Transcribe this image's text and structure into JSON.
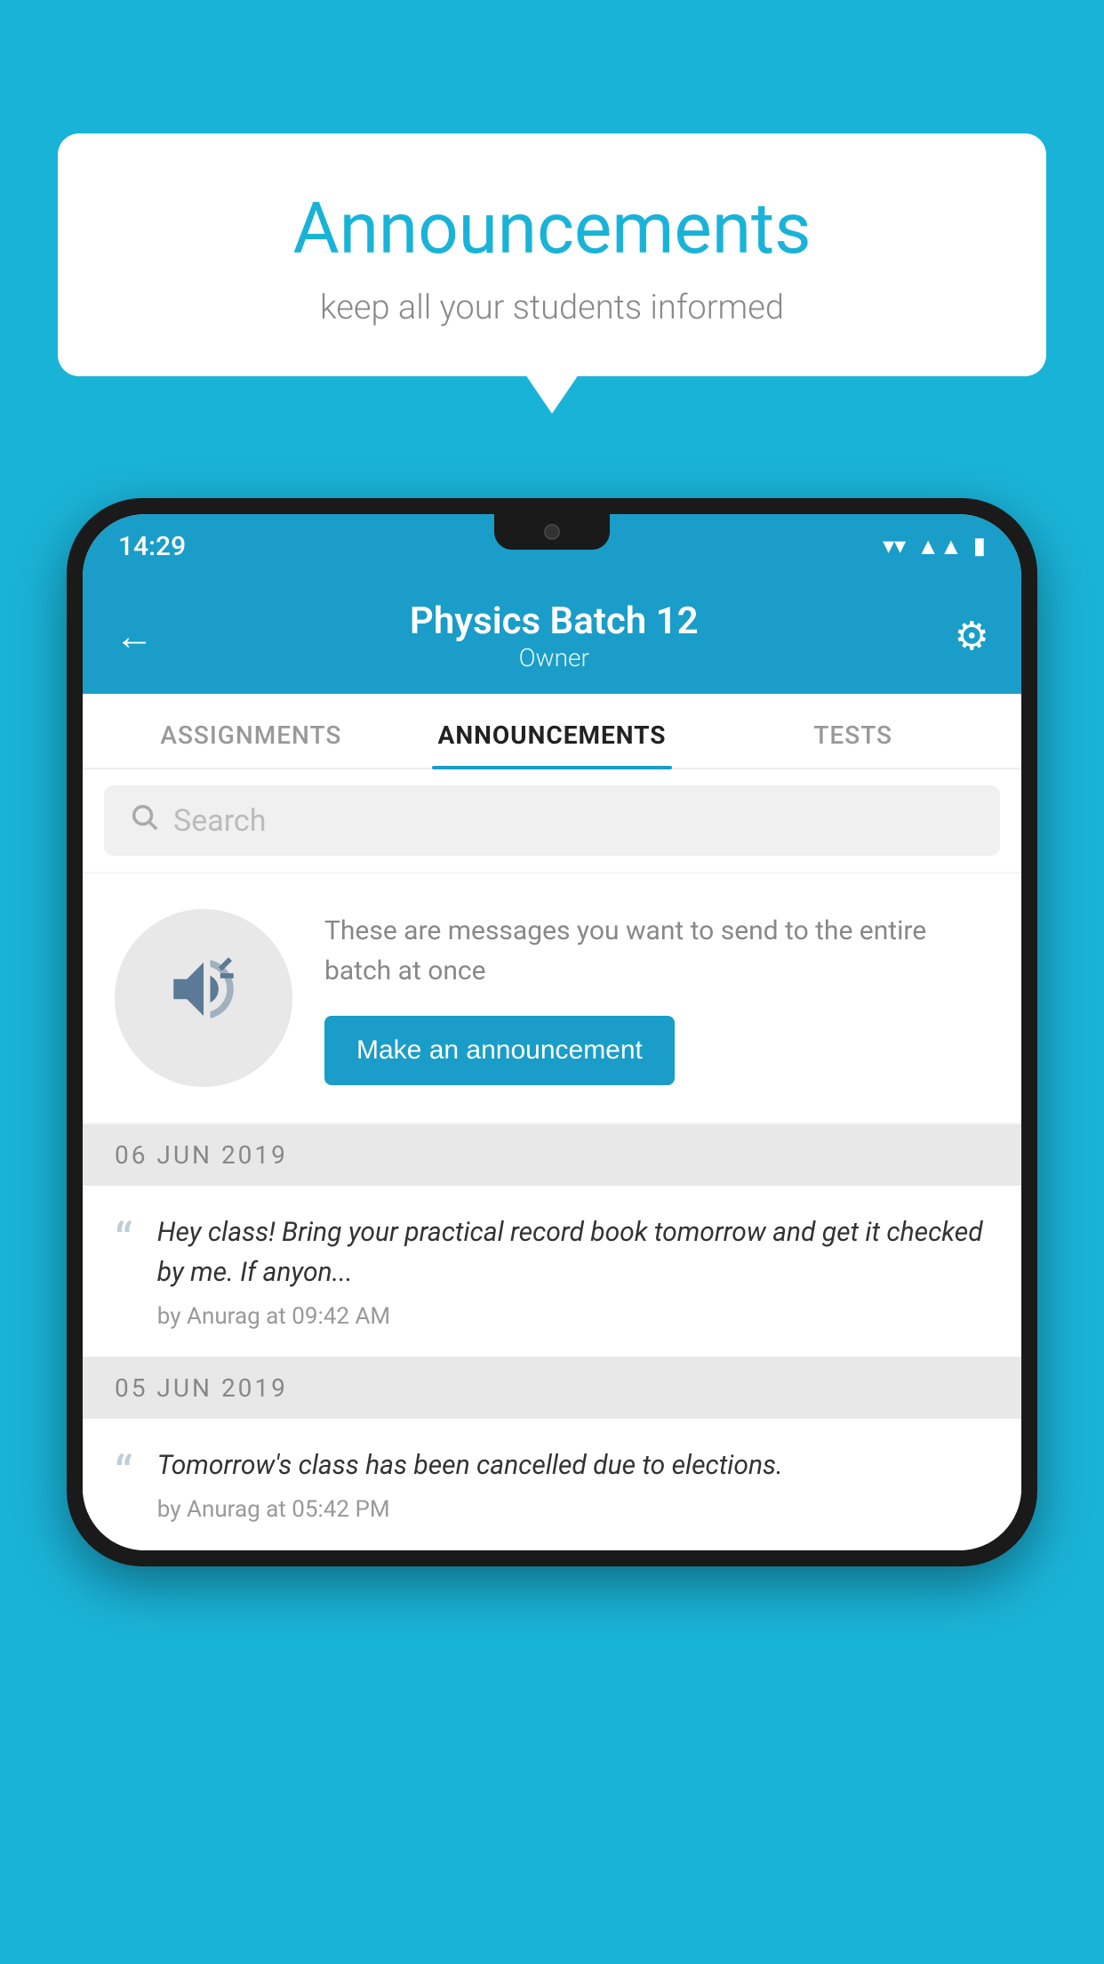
{
  "background_color": "#1ab3d8",
  "speech_bubble": {
    "title": "Announcements",
    "subtitle": "keep all your students informed"
  },
  "status_bar": {
    "time": "14:29",
    "icons": [
      "wifi",
      "signal",
      "battery"
    ]
  },
  "app_header": {
    "back_label": "←",
    "title": "Physics Batch 12",
    "subtitle": "Owner",
    "gear_label": "⚙"
  },
  "tabs": [
    {
      "label": "ASSIGNMENTS",
      "active": false
    },
    {
      "label": "ANNOUNCEMENTS",
      "active": true
    },
    {
      "label": "TESTS",
      "active": false
    },
    {
      "label": "...",
      "active": false
    }
  ],
  "search": {
    "placeholder": "Search"
  },
  "promo_card": {
    "description": "These are messages you want to send to the entire batch at once",
    "button_label": "Make an announcement"
  },
  "announcements": [
    {
      "date": "06  JUN  2019",
      "text": "Hey class! Bring your practical record book tomorrow and get it checked by me. If anyon...",
      "meta": "by Anurag at 09:42 AM"
    },
    {
      "date": "05  JUN  2019",
      "text": "Tomorrow's class has been cancelled due to elections.",
      "meta": "by Anurag at 05:42 PM"
    }
  ]
}
